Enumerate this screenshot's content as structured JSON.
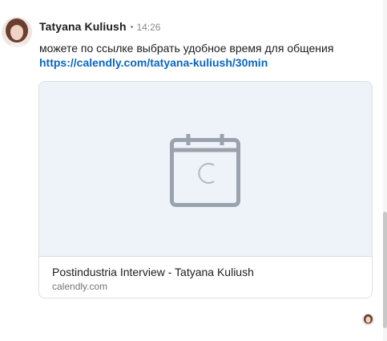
{
  "message": {
    "sender_name": "Tatyana Kuliush",
    "separator": "•",
    "timestamp": "14:26",
    "text": "можете по ссылке выбрать удобное время для общения ",
    "link_text": "https://calendly.com/tatyana-kuliush/30min",
    "link_color": "#0a66c2"
  },
  "link_preview": {
    "icon": "calendar-icon",
    "title": "Postindustria Interview - Tatyana Kuliush",
    "domain": "calendly.com"
  },
  "colors": {
    "preview_background": "#edf3f8",
    "icon_gray": "#9aa2ad"
  }
}
